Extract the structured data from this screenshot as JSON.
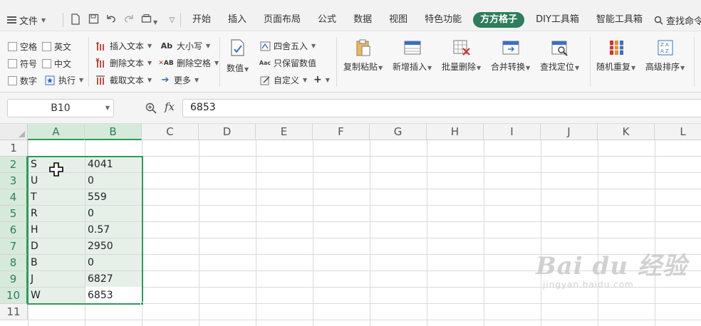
{
  "menubar": {
    "file_label": "文件",
    "tabs": [
      {
        "label": "开始"
      },
      {
        "label": "插入"
      },
      {
        "label": "页面布局"
      },
      {
        "label": "公式"
      },
      {
        "label": "数据"
      },
      {
        "label": "视图"
      },
      {
        "label": "特色功能"
      },
      {
        "label": "方方格子",
        "active": true
      },
      {
        "label": "DIY工具箱"
      },
      {
        "label": "智能工具箱"
      }
    ],
    "search_label": "查找命令、"
  },
  "ribbon": {
    "checks": {
      "space": "空格",
      "english": "英文",
      "symbol": "符号",
      "chinese": "中文",
      "number": "数字"
    },
    "execute": "执行",
    "insert_text": "插入文本",
    "delete_text": "删除文本",
    "extract_text": "截取文本",
    "case": "大小写",
    "delete_space": "删除空格",
    "more": "更多",
    "numeric": "数值",
    "round": "四舍五入",
    "keep_values": "只保留数值",
    "custom": "自定义",
    "big_buttons": {
      "copy_paste": "复制粘贴",
      "new_insert": "新增插入",
      "batch_delete": "批量删除",
      "merge_convert": "合并转换",
      "find_locate": "查找定位",
      "random_repeat": "随机重复",
      "advanced_sort": "高级排序"
    },
    "colors": {
      "accent": "#2e7d5b",
      "selection": "#2e9a5c"
    }
  },
  "formula_bar": {
    "name_box": "B10",
    "fx_label": "fx",
    "value": "6853"
  },
  "grid": {
    "columns": [
      "A",
      "B",
      "C",
      "D",
      "E",
      "F",
      "G",
      "H",
      "I",
      "J",
      "K",
      "L"
    ],
    "rows": [
      "1",
      "2",
      "3",
      "4",
      "5",
      "6",
      "7",
      "8",
      "9",
      "10",
      "11"
    ],
    "data": [
      {
        "a": "S",
        "b": "4041"
      },
      {
        "a": "U",
        "b": "0"
      },
      {
        "a": "T",
        "b": "559"
      },
      {
        "a": "R",
        "b": "0"
      },
      {
        "a": "H",
        "b": "0.57"
      },
      {
        "a": "D",
        "b": "2950"
      },
      {
        "a": "B",
        "b": "0"
      },
      {
        "a": "J",
        "b": "6827"
      },
      {
        "a": "W",
        "b": "6853"
      }
    ]
  },
  "watermark": {
    "main": "Bai du 经验",
    "sub": "jingyan.baidu.com"
  }
}
